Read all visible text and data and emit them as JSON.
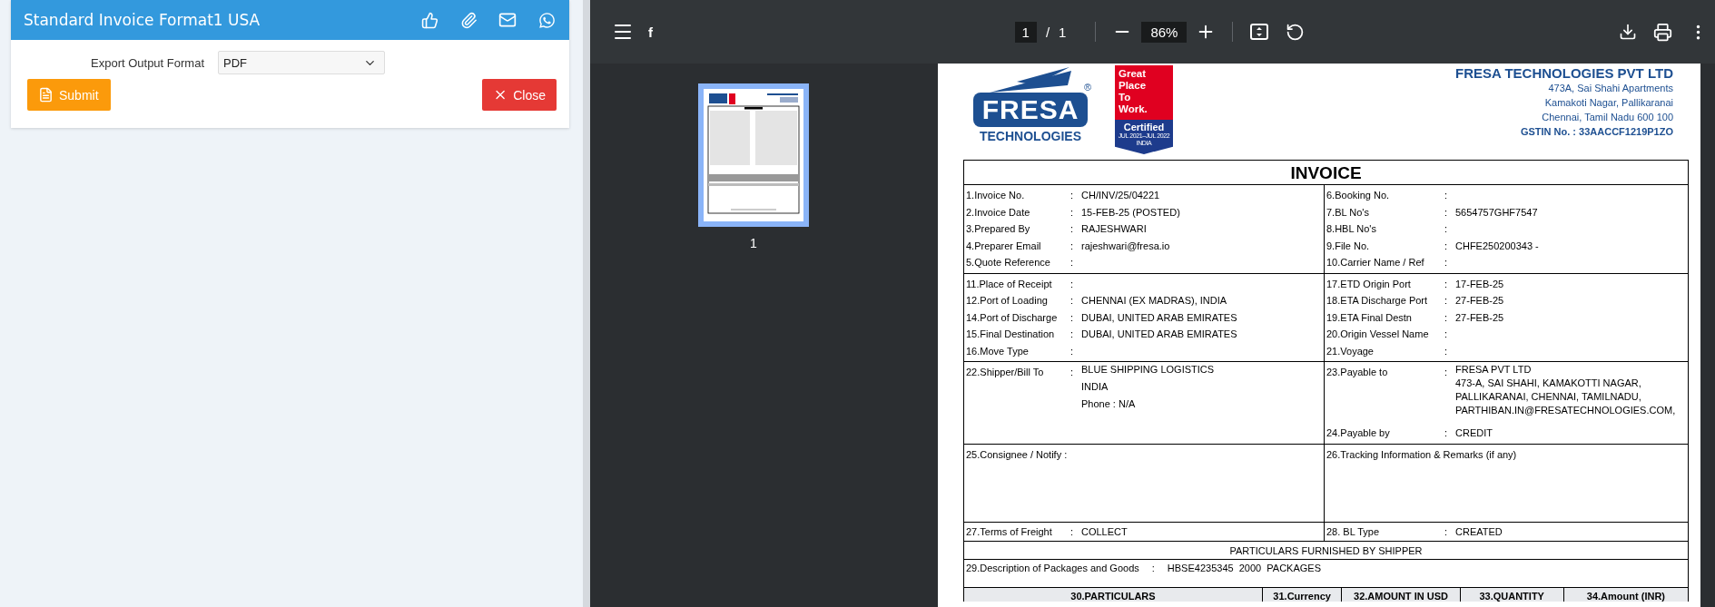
{
  "panel": {
    "title": "Standard Invoice Format1 USA",
    "field": {
      "label": "Export Output Format",
      "value": "PDF"
    },
    "buttons": [
      {
        "kind": "submit",
        "label": "Submit"
      },
      {
        "kind": "close",
        "label": "Close"
      }
    ]
  },
  "viewer": {
    "title": "f",
    "page": "1",
    "page_separator": "/",
    "page_total": "1",
    "zoom": "86%",
    "thumbnails": [
      {
        "label": "1",
        "selected": true
      }
    ]
  },
  "document": {
    "logo": {
      "name": "FRESA",
      "tagline": "TECHNOLOGIES",
      "mark": "®"
    },
    "badge": {
      "lines": [
        "Great",
        "Place",
        "To",
        "Work."
      ],
      "certified": "Certified",
      "period": "JUL 2021–JUL 2022",
      "country": "INDIA"
    },
    "company": {
      "name": "FRESA TECHNOLOGIES PVT LTD",
      "address": [
        "473A, Sai Shahi Apartments",
        "Kamakoti Nagar, Pallikaranai",
        "Chennai, Tamil Nadu 600 100"
      ],
      "gstin": "GSTIN No. : 33AACCF1219P1ZO"
    },
    "title": "INVOICE",
    "sections": [
      {
        "kind": "pairs",
        "left": [
          {
            "label": "1.Invoice No.",
            "sep": ":",
            "value": "CH/INV/25/04221"
          },
          {
            "label": "2.Invoice Date",
            "sep": ":",
            "value": "15-FEB-25 (POSTED)"
          },
          {
            "label": "3.Prepared By",
            "sep": ":",
            "value": "RAJESHWARI"
          },
          {
            "label": "4.Preparer Email",
            "sep": ":",
            "value": "rajeshwari@fresa.io"
          },
          {
            "label": "5.Quote Reference",
            "sep": ":"
          }
        ],
        "right": [
          {
            "label": "6.Booking No.",
            "sep": ":"
          },
          {
            "label": "7.BL No's",
            "sep": ":",
            "value": "5654757GHF7547"
          },
          {
            "label": "8.HBL No's",
            "sep": ":"
          },
          {
            "label": "9.File No.",
            "sep": ":",
            "value": "CHFE250200343 -"
          },
          {
            "label": "10.Carrier Name / Ref",
            "sep": ":"
          }
        ]
      },
      {
        "kind": "pairs",
        "left": [
          {
            "label": "11.Place of Receipt",
            "sep": ":"
          },
          {
            "label": "12.Port of Loading",
            "sep": ":",
            "value": "CHENNAI (EX MADRAS), INDIA"
          },
          {
            "label": "14.Port of Discharge",
            "sep": ":",
            "value": "DUBAI, UNITED ARAB EMIRATES"
          },
          {
            "label": "15.Final Destination",
            "sep": ":",
            "value": "DUBAI, UNITED ARAB EMIRATES"
          },
          {
            "label": "16.Move Type",
            "sep": ":"
          }
        ],
        "right": [
          {
            "label": "17.ETD Origin Port",
            "sep": ":",
            "value": "17-FEB-25"
          },
          {
            "label": "18.ETA Discharge Port",
            "sep": ":",
            "value": "27-FEB-25"
          },
          {
            "label": "19.ETA Final Destn",
            "sep": ":",
            "value": "27-FEB-25"
          },
          {
            "label": "20.Origin Vessel Name",
            "sep": ":"
          },
          {
            "label": "21.Voyage",
            "sep": ":"
          }
        ]
      },
      {
        "kind": "party",
        "left": {
          "label": "22.Shipper/Bill To",
          "sep": ":",
          "lines": [
            "BLUE SHIPPING LOGISTICS",
            "INDIA",
            "Phone : N/A"
          ]
        },
        "right": {
          "label": "23.Payable to",
          "sep": ":",
          "lines": [
            "FRESA PVT LTD",
            "473-A, SAI SHAHI, KAMAKOTTI NAGAR,",
            "PALLIKARANAI, CHENNAI, TAMILNADU,",
            "PARTHIBAN.IN@FRESATECHNOLOGIES.COM,"
          ],
          "footer": {
            "label": "24.Payable by",
            "sep": ":",
            "value": "CREDIT"
          }
        }
      },
      {
        "kind": "notes",
        "left": {
          "label": "25.Consignee / Notify",
          "sep": ":"
        },
        "right": {
          "label": "26.Tracking Information & Remarks (if any)"
        }
      },
      {
        "kind": "pairs",
        "left": [
          {
            "label": "27.Terms of Freight",
            "sep": ":",
            "value": "COLLECT"
          }
        ],
        "right": [
          {
            "label": "28. BL Type",
            "sep": ":",
            "value": "CREATED"
          }
        ]
      },
      {
        "kind": "banner",
        "text": "PARTICULARS FURNISHED BY SHIPPER"
      },
      {
        "kind": "line",
        "label": "29.Description of Packages and Goods",
        "sep": ":",
        "value": "HBSE4235345  2000  PACKAGES"
      },
      {
        "kind": "columns",
        "columns": [
          "30.PARTICULARS",
          "31.Currency",
          "32.AMOUNT IN USD",
          "33.QUANTITY",
          "34.Amount (INR)"
        ]
      }
    ]
  }
}
